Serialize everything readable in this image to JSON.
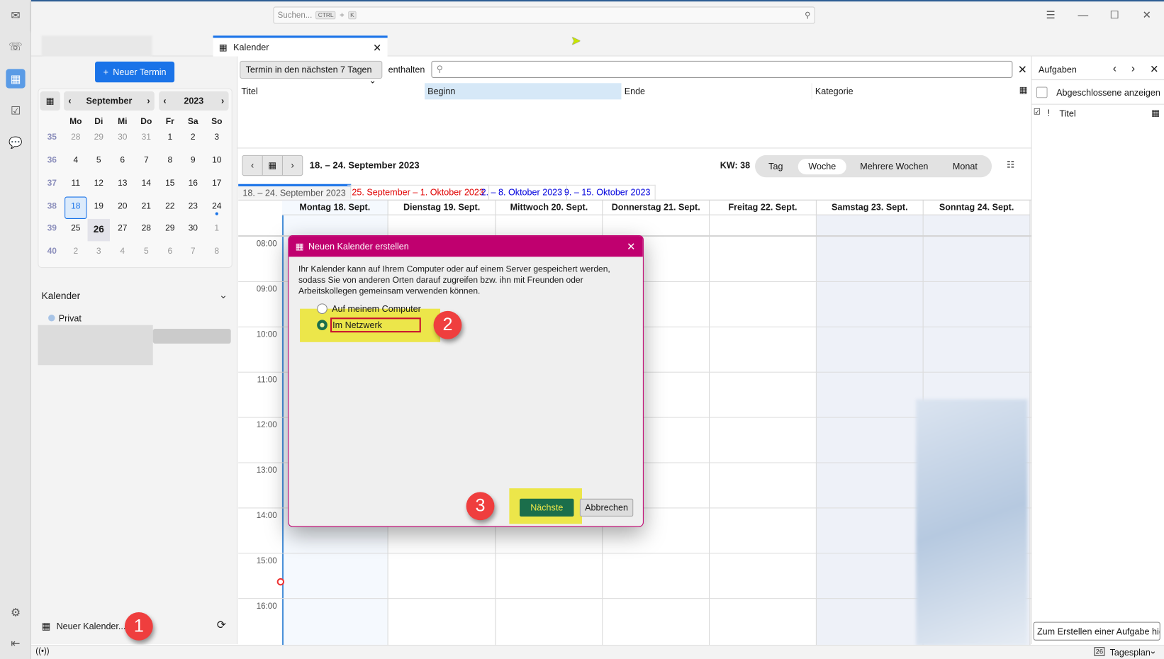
{
  "topbar": {
    "search_placeholder": "Suchen...",
    "shortcut_key1": "CTRL",
    "shortcut_plus": "+",
    "shortcut_key2": "K"
  },
  "tab": {
    "label": "Kalender"
  },
  "sidebar": {
    "new_event": "Neuer Termin",
    "mini_calendar": {
      "month": "September",
      "year": "2023",
      "weekdays": [
        "Mo",
        "Di",
        "Mi",
        "Do",
        "Fr",
        "Sa",
        "So"
      ],
      "weeks": [
        {
          "kw": "35",
          "days": [
            "28",
            "29",
            "30",
            "31",
            "1",
            "2",
            "3"
          ]
        },
        {
          "kw": "36",
          "days": [
            "4",
            "5",
            "6",
            "7",
            "8",
            "9",
            "10"
          ]
        },
        {
          "kw": "37",
          "days": [
            "11",
            "12",
            "13",
            "14",
            "15",
            "16",
            "17"
          ]
        },
        {
          "kw": "38",
          "days": [
            "18",
            "19",
            "20",
            "21",
            "22",
            "23",
            "24"
          ]
        },
        {
          "kw": "39",
          "days": [
            "25",
            "26",
            "27",
            "28",
            "29",
            "30",
            "1"
          ]
        },
        {
          "kw": "40",
          "days": [
            "2",
            "3",
            "4",
            "5",
            "6",
            "7",
            "8"
          ]
        }
      ],
      "selected_day": "18",
      "today": "26"
    },
    "calendars_header": "Kalender",
    "calendars": [
      {
        "name": "Privat",
        "color": "#a8c4e6"
      }
    ],
    "new_calendar": "Neuer Kalender..."
  },
  "filter": {
    "range": "Termin in den nächsten 7 Tagen",
    "contains_label": "enthalten",
    "search_value": ""
  },
  "list_columns": [
    "Titel",
    "Beginn",
    "Ende",
    "Kategorie"
  ],
  "week_nav": {
    "title": "18. – 24. September 2023",
    "kw": "KW: 38",
    "views": [
      "Tag",
      "Woche",
      "Mehrere Wochen",
      "Monat"
    ],
    "active_view": "Woche"
  },
  "week_tabs": [
    {
      "label": "18. – 24. September 2023",
      "color": "#555555"
    },
    {
      "label": "25. September – 1. Oktober 2023",
      "color": "#e00000"
    },
    {
      "label": "2. – 8. Oktober 2023",
      "color": "#0000dd"
    },
    {
      "label": "9. – 15. Oktober 2023",
      "color": "#0000dd"
    }
  ],
  "days": [
    "Montag 18. Sept.",
    "Dienstag 19. Sept.",
    "Mittwoch 20. Sept.",
    "Donnerstag 21. Sept.",
    "Freitag 22. Sept.",
    "Samstag 23. Sept.",
    "Sonntag 24. Sept."
  ],
  "hours": [
    "08:00",
    "09:00",
    "10:00",
    "11:00",
    "12:00",
    "13:00",
    "14:00",
    "15:00",
    "16:00"
  ],
  "tasks": {
    "title": "Aufgaben",
    "show_completed": "Abgeschlossene anzeigen",
    "col_priority": "!",
    "col_title": "Titel",
    "new_task_placeholder": "Zum Erstellen einer Aufgabe hier"
  },
  "statusbar": {
    "today_pane": "Tagesplan",
    "today_num": "26"
  },
  "dialog": {
    "title": "Neuen Kalender erstellen",
    "description": "Ihr Kalender kann auf Ihrem Computer oder auf einem Server gespeichert werden, sodass Sie von anderen Orten darauf zugreifen bzw. ihn mit Freunden oder Arbeitskollegen gemeinsam verwenden können.",
    "options": [
      {
        "label": "Auf meinem Computer",
        "selected": false
      },
      {
        "label": "Im Netzwerk",
        "selected": true
      }
    ],
    "next": "Nächste",
    "cancel": "Abbrechen"
  },
  "annotations": [
    "1",
    "2",
    "3"
  ],
  "colors": {
    "accent": "#1a73e8",
    "dialog": "#c0006f",
    "next_button": "#1b6e4b",
    "highlight": "#ece64a",
    "badge": "#ef3e3e"
  }
}
